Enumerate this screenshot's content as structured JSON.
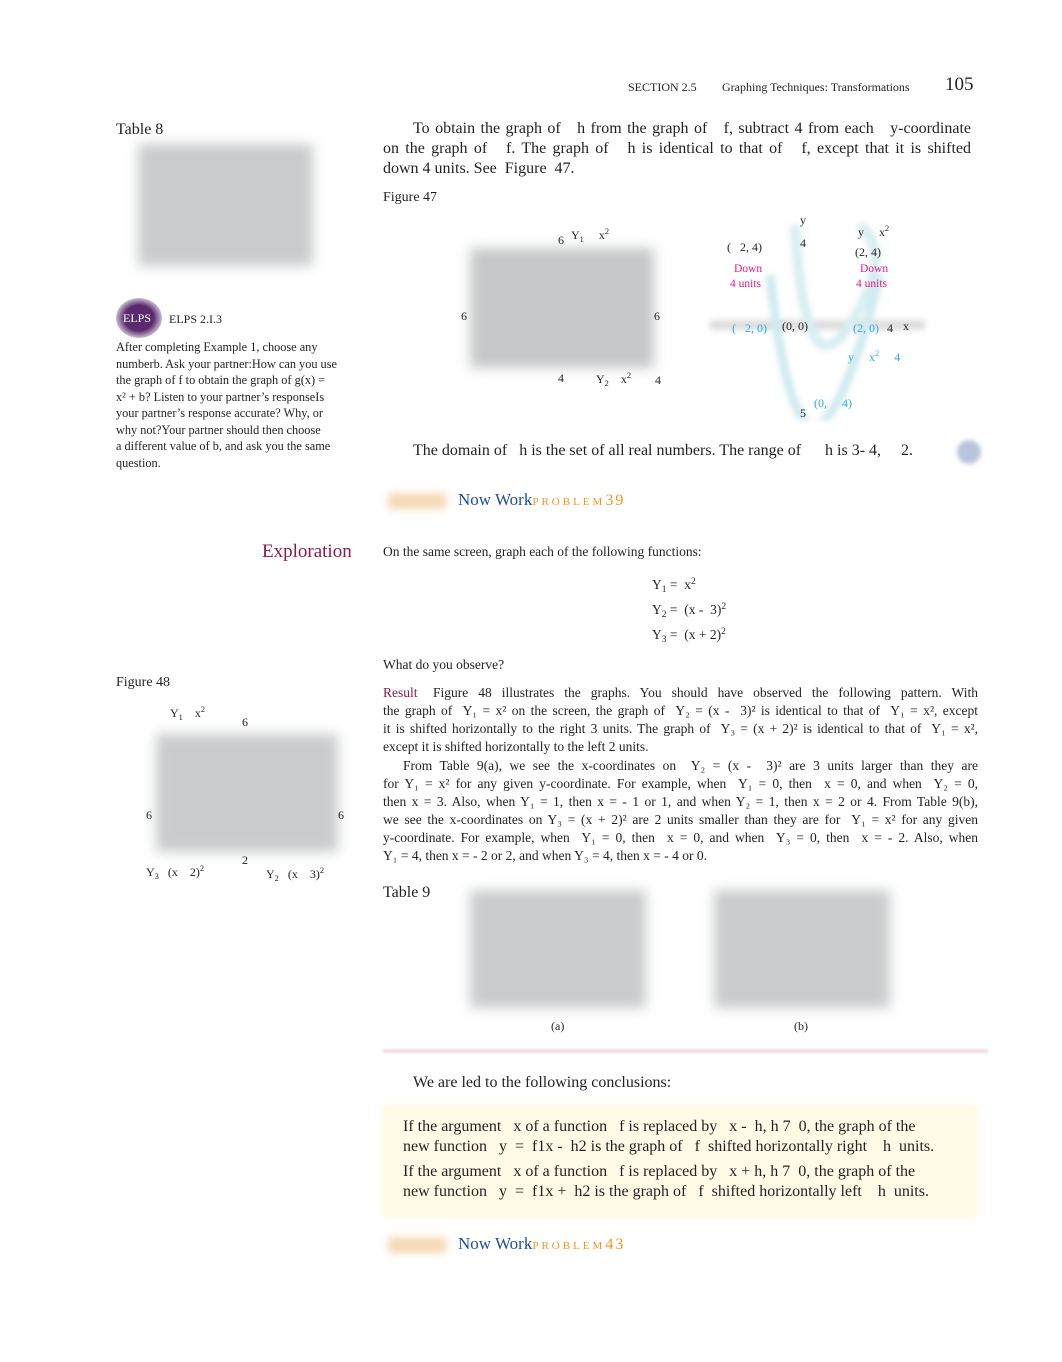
{
  "header": {
    "section": "SECTION 2.5",
    "title": "Graphing Techniques: Transformations",
    "page": "105"
  },
  "sidebar": {
    "table8_label": "Table 8",
    "elps_badge": "ELPS",
    "elps_code": "ELPS 2.I.3",
    "elps_lines": [
      "After completing Example 1, choose any",
      "numberb. Ask your partner:How can you use",
      "the graph of f to obtain the graph of g(x) =",
      "x² + b? Listen to your partner’s responseIs",
      "your partner’s response accurate? Why, or",
      "why not?Your partner should then choose",
      "a different value of b, and ask you the same",
      "question."
    ],
    "exploration": "Exploration",
    "figure48_label": "Figure 48",
    "fig48": {
      "y1": "Y",
      "y1sub": "1",
      "y1eq": "x",
      "top": "6",
      "left": "6",
      "right": "6",
      "bottom": "2",
      "y3": "Y",
      "y3sub": "3",
      "y3eq": "(x    2)",
      "y2": "Y",
      "y2sub": "2",
      "y2eq": "(x    3)",
      "sq": "2"
    }
  },
  "main": {
    "intro_lines": [
      "To obtain the graph of   h from the graph of   f, subtract 4 from each   y-coordinate",
      "on the graph of   f. The graph of   h is identical to that of   f, except that it is shifted",
      "down 4 units. See  Figure  47."
    ],
    "figure47_label": "Figure 47",
    "fig47_screen": {
      "top": "6",
      "y1": "Y",
      "y1sub": "1",
      "eq": "x",
      "sq": "2",
      "left": "6",
      "right": "6",
      "bottom": "4",
      "y2": "Y",
      "y2sub": "2",
      "bottom2": "4"
    },
    "fig47_graph": {
      "yaxis": "y",
      "four": "4",
      "p1": "(   2, 4)",
      "p2": "(2, 4)",
      "eq_top": "y     x",
      "down": "Down",
      "units": "4 units",
      "c1": "(   2, 0)",
      "c2": "(0, 0)",
      "c3": "(2, 0)",
      "xfour": "4",
      "xaxis": "x",
      "eq_bottom": "y     x",
      "eq_bottom_tail": "4",
      "vertex": "(0,     4)",
      "five": "5"
    },
    "domain_line": "The domain of   h is the set of all real numbers. The range of      h is 3- 4,     2.",
    "nowwork1": {
      "label": "Now Work",
      "problem": "PROBLEM",
      "num": "39"
    },
    "exploration_intro": "On the same screen, graph each of the following functions:",
    "equations": [
      {
        "y": "Y",
        "sub": "1",
        "rhs": " =  x",
        "sup": "2"
      },
      {
        "y": "Y",
        "sub": "2",
        "rhs": " =  (x -  3)",
        "sup": "2"
      },
      {
        "y": "Y",
        "sub": "3",
        "rhs": " =  (x + 2)",
        "sup": "2"
      }
    ],
    "observe": "What do you observe?",
    "result_label": "Result",
    "result_lines": [
      "Figure 48 illustrates the graphs. You should have observed the following pattern. With",
      "the graph of  Y₁ = x² on the screen, the graph of  Y₂ = (x -  3)² is identical to that of  Y₁ = x², except",
      "it is shifted horizontally to the right 3 units. The graph of  Y₃ = (x + 2)² is identical to that of  Y₁ = x²,",
      "except it is shifted horizontally to the left 2 units.",
      "From Table 9(a), we see the x-coordinates on  Y₂ = (x -  3)² are 3 units larger than they are",
      "for Y₁ = x² for any given y-coordinate. For example, when  Y₁ = 0, then  x = 0, and when  Y₂ = 0,",
      "then x = 3. Also, when Y₁ = 1, then x = - 1 or 1, and when Y₂ = 1, then x = 2 or 4. From Table 9(b),",
      "we see the x-coordinates on Y₃ = (x + 2)² are 2 units smaller than they are for  Y₁ = x² for any given",
      "y-coordinate. For example, when  Y₁ = 0, then  x = 0, and when  Y₃ = 0, then  x = - 2. Also, when",
      "Y₁ = 4, then x = - 2 or 2, and when Y₃ = 4, then x = - 4 or 0."
    ],
    "table9_label": "Table 9",
    "table9_a": "(a)",
    "table9_b": "(b)",
    "conclusion_intro": "We are led to the following conclusions:",
    "box_lines": [
      "If the argument   x of a function   f is replaced by   x -  h, h 7  0, the graph of the",
      "new function   y  =  f1x -  h2 is the graph of   f  shifted horizontally right    h  units.",
      "If the argument   x of a function   f is replaced by   x + h, h 7  0, the graph of the",
      "new function   y  =  f1x +  h2 is the graph of   f  shifted horizontally left    h  units."
    ],
    "nowwork2": {
      "label": "Now Work",
      "problem": "PROBLEM",
      "num": "43"
    }
  },
  "colors": {
    "exploration": "#8b1a4a",
    "nowwork": "#1f4e9a",
    "problem": "#f7931e",
    "down": "#e5197f",
    "cyan": "#29abe2",
    "box": "#fffbe6",
    "elps": "#5b2a6e"
  }
}
